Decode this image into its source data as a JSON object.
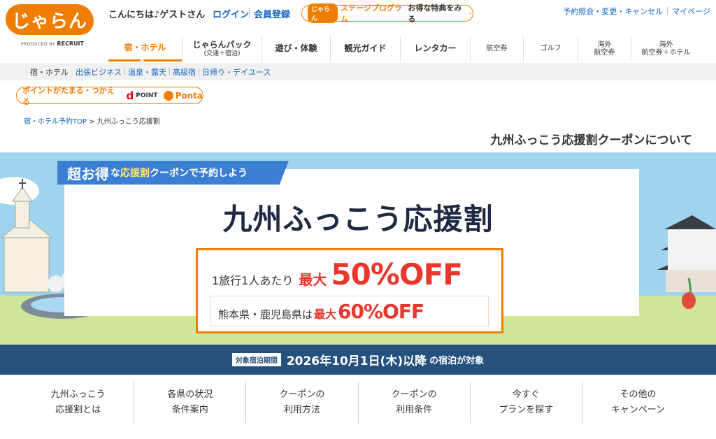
{
  "header": {
    "logo_text": "じゃらん",
    "produced_by": "PRODUCED BY",
    "produced_brand": "RECRUIT",
    "greeting": "こんにちは♪ゲストさん",
    "login": "ログイン",
    "register": "会員登録",
    "stage_logo": "じゃらん",
    "stage_program": "ステージプログラム",
    "stage_deal": "お得な特典をみる",
    "link_reservation": "予約照会・変更・キャンセル",
    "link_mypage": "マイページ"
  },
  "nav": [
    {
      "label": "宿・ホテル",
      "sub": ""
    },
    {
      "label": "じゃらんパック",
      "sub": "(交通＋宿泊)"
    },
    {
      "label": "遊び・体験",
      "sub": ""
    },
    {
      "label": "観光ガイド",
      "sub": ""
    },
    {
      "label": "レンタカー",
      "sub": ""
    },
    {
      "label": "航空券",
      "sub": ""
    },
    {
      "label": "ゴルフ",
      "sub": ""
    },
    {
      "label": "海外",
      "sub": "航空券"
    },
    {
      "label": "海外",
      "sub": "航空券＋ホテル"
    }
  ],
  "subnav": {
    "current": "宿・ホテル",
    "links": [
      "出張ビジネス",
      "温泉・露天",
      "高級宿",
      "日帰り・デイユース"
    ]
  },
  "points": {
    "text": "ポイントがたまる・つかえる",
    "dpoint_mark": "d",
    "dpoint_text": "POINT",
    "ponta": "Ponta"
  },
  "breadcrumb": {
    "top": "宿・ホテル予約TOP",
    "separator": ">",
    "current": "九州ふっこう応援割"
  },
  "page_heading": "九州ふっこう応援割クーポンについて",
  "banner": {
    "ribbon_big": "超お得",
    "ribbon_mid": "な",
    "ribbon_accent": "応援割",
    "ribbon_rest": "クーポンで予約しよう",
    "title": "九州ふっこう応援割",
    "offer1_prefix": "1旅行1人あたり",
    "offer1_max": "最大",
    "offer1_value": "50%OFF",
    "offer2_prefix": "熊本県・鹿児島県は",
    "offer2_max": "最大",
    "offer2_value": "60%OFF"
  },
  "period": {
    "tag": "対象宿泊期間",
    "date": "2026年10月1日(木)以降",
    "suffix": "の宿泊が対象"
  },
  "bottom_nav": [
    {
      "l1": "九州ふっこう",
      "l2": "応援割とは"
    },
    {
      "l1": "各県の状況",
      "l2": "条件案内"
    },
    {
      "l1": "クーポンの",
      "l2": "利用方法"
    },
    {
      "l1": "クーポンの",
      "l2": "利用条件"
    },
    {
      "l1": "今すぐ",
      "l2": "プランを探す"
    },
    {
      "l1": "その他の",
      "l2": "キャンペーン"
    }
  ],
  "colors": {
    "brand_orange": "#ef7d00",
    "link_blue": "#1565c0",
    "period_navy": "#26517f",
    "offer_red": "#e8382d"
  }
}
